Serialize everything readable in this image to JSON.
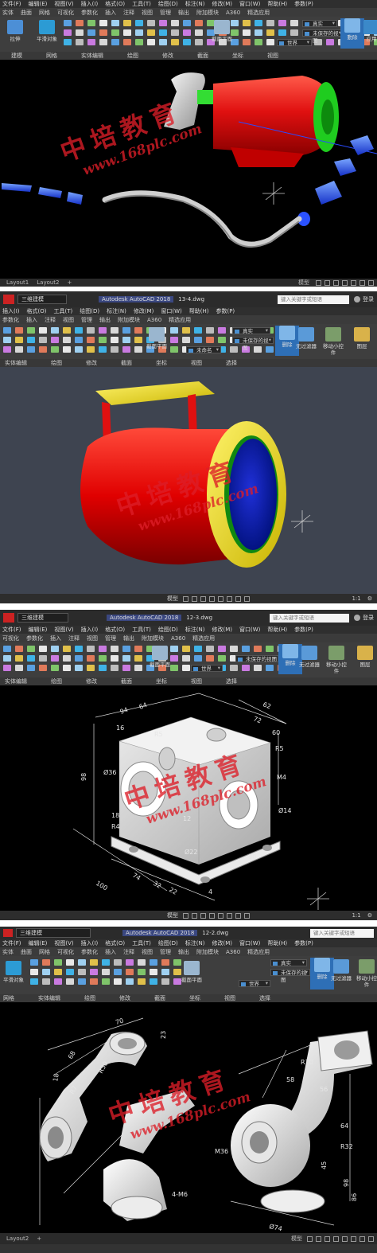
{
  "colors": {
    "ribbon_bg": "#3e3e3e",
    "viewport_black": "#000000",
    "viewport_gray": "#3e4450",
    "watermark": "#dc1e28",
    "accent_blue": "#3c7dc4"
  },
  "watermark": {
    "title": "中培教育",
    "url": "www.168plc.com"
  },
  "window": {
    "title": "Autodesk AutoCAD 2018",
    "workspace": "三维建模",
    "search_placeholder": "键入关键字或短语",
    "login": "登录"
  },
  "panel1": {
    "menus": [
      "文件(F)",
      "编辑(E)",
      "视图(V)",
      "插入(I)",
      "格式(O)",
      "工具(T)",
      "绘图(D)",
      "标注(N)",
      "修改(M)",
      "窗口(W)",
      "帮助(H)",
      "参数(P)"
    ],
    "tabs": [
      "实体",
      "曲面",
      "网格",
      "可视化",
      "参数化",
      "插入",
      "注释",
      "视图",
      "管理",
      "输出",
      "附加模块",
      "A360",
      "精选应用"
    ],
    "big_buttons": [
      "拉伸",
      "平滑对象"
    ],
    "big_btn_right": [
      "截面平面",
      "動除",
      "应用"
    ],
    "panel_labels": [
      "建模",
      "网格",
      "实体编辑",
      "绘图",
      "修改",
      "截面",
      "坐标",
      "视图"
    ],
    "combo_visual": "真实",
    "combo_view": "未保存的视图",
    "combo_ucs": "世界",
    "layout_tabs": [
      "Layout1",
      "Layout2",
      "+"
    ],
    "status_model": "模型"
  },
  "panel2": {
    "file": "13-4.dwg",
    "menus": [
      "插入(I)",
      "格式(O)",
      "工具(T)",
      "绘图(D)",
      "标注(N)",
      "修改(M)",
      "窗口(W)",
      "帮助(H)",
      "参数(P)"
    ],
    "tabs": [
      "参数化",
      "插入",
      "注释",
      "视图",
      "管理",
      "输出",
      "附加模块",
      "A360",
      "精选应用"
    ],
    "big_buttons": [
      "截面平面",
      "删除",
      "无过滤器",
      "移动小控件",
      "图层"
    ],
    "panel_labels": [
      "实体编辑",
      "绘图",
      "修改",
      "截面",
      "坐标",
      "视图",
      "选择"
    ],
    "combo_visual": "真实",
    "combo_view": "未保存的视图",
    "combo_ucs": "未命名",
    "status_model": "模型",
    "scale": "1:1"
  },
  "panel3": {
    "file": "12-3.dwg",
    "menus": [
      "文件(F)",
      "编辑(E)",
      "视图(V)",
      "插入(I)",
      "格式(O)",
      "工具(T)",
      "绘图(D)",
      "标注(N)",
      "修改(M)",
      "窗口(W)",
      "帮助(H)",
      "参数(P)"
    ],
    "tabs": [
      "可视化",
      "参数化",
      "插入",
      "注释",
      "视图",
      "管理",
      "输出",
      "附加模块",
      "A360",
      "精选应用"
    ],
    "big_buttons": [
      "截面平面",
      "删除",
      "无过滤器",
      "移动小控件",
      "图层"
    ],
    "panel_labels": [
      "实体编辑",
      "绘图",
      "修改",
      "截面",
      "坐标",
      "视图",
      "选择"
    ],
    "combo_view": "未保存的视图",
    "combo_ucs": "世界",
    "dims": [
      "94",
      "64",
      "62",
      "72",
      "16",
      "60",
      "R5",
      "R5",
      "98",
      "Ø36",
      "M4",
      "Ø14",
      "100",
      "74",
      "32",
      "22",
      "80",
      "18",
      "R4",
      "Ø22",
      "12",
      "4"
    ],
    "status_model": "模型",
    "scale": "1:1"
  },
  "panel4": {
    "file": "12-2.dwg",
    "menus": [
      "文件(F)",
      "编辑(E)",
      "视图(V)",
      "插入(I)",
      "格式(O)",
      "工具(T)",
      "绘图(D)",
      "标注(N)",
      "修改(M)",
      "窗口(W)",
      "帮助(H)",
      "参数(P)"
    ],
    "tabs": [
      "实体",
      "曲面",
      "网格",
      "可视化",
      "参数化",
      "插入",
      "注释",
      "视图",
      "管理",
      "输出",
      "附加模块",
      "A360",
      "精选应用"
    ],
    "big_buttons": [
      "平滑对象",
      "截面平面",
      "删除",
      "无过滤器",
      "移动小控件"
    ],
    "panel_labels": [
      "网格",
      "实体编辑",
      "绘图",
      "修改",
      "截面",
      "坐标",
      "视图",
      "选择"
    ],
    "combo_visual": "真实",
    "combo_view": "未保存的视图",
    "combo_ucs": "世界",
    "dims": [
      "70",
      "68",
      "R30",
      "R7",
      "18",
      "23",
      "R10",
      "58",
      "64",
      "R32",
      "56",
      "4-M6",
      "M36",
      "Ø74",
      "45",
      "98",
      "86"
    ],
    "layout_tabs": [
      "Layout2",
      "+"
    ],
    "status_model": "模型"
  }
}
